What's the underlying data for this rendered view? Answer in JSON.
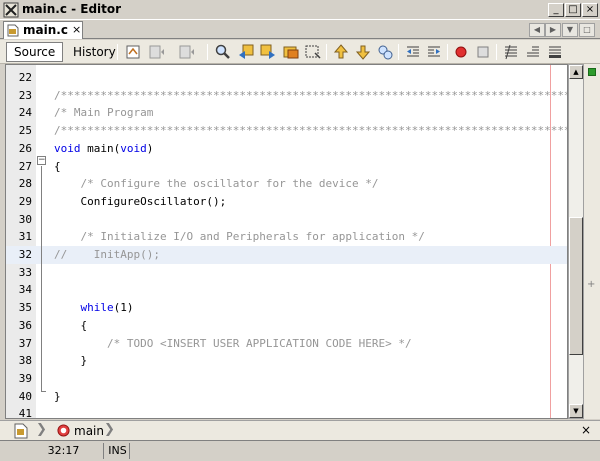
{
  "window": {
    "title": "main.c - Editor",
    "buttons": {
      "minimize": "_",
      "maximize": "□",
      "close": "×"
    }
  },
  "tabs": [
    {
      "label": "main.c",
      "close": "×"
    }
  ],
  "toolbar": {
    "source_label": "Source",
    "history_label": "History"
  },
  "editor": {
    "current_line": 32,
    "lines": [
      {
        "n": "22",
        "text": ""
      },
      {
        "n": "23",
        "text": "/******************************************************************************/"
      },
      {
        "n": "24",
        "text": "/* Main Program                                                               */"
      },
      {
        "n": "25",
        "text": "/******************************************************************************/"
      },
      {
        "n": "26",
        "text": "void main(void)"
      },
      {
        "n": "27",
        "text": "{"
      },
      {
        "n": "28",
        "text": "    /* Configure the oscillator for the device */"
      },
      {
        "n": "29",
        "text": "    ConfigureOscillator();"
      },
      {
        "n": "30",
        "text": ""
      },
      {
        "n": "31",
        "text": "    /* Initialize I/O and Peripherals for application */"
      },
      {
        "n": "32",
        "text": "//    InitApp();"
      },
      {
        "n": "33",
        "text": ""
      },
      {
        "n": "34",
        "text": ""
      },
      {
        "n": "35",
        "text": "    while(1)"
      },
      {
        "n": "36",
        "text": "    {"
      },
      {
        "n": "37",
        "text": "        /* TODO <INSERT USER APPLICATION CODE HERE> */"
      },
      {
        "n": "38",
        "text": "    }"
      },
      {
        "n": "39",
        "text": ""
      },
      {
        "n": "40",
        "text": "}"
      },
      {
        "n": "41",
        "text": ""
      }
    ]
  },
  "breadcrumb": {
    "function_label": "main",
    "close": "×"
  },
  "statusbar": {
    "position": "32:17",
    "mode": "INS"
  },
  "colors": {
    "keyword": "#0000e6",
    "comment": "#969696",
    "current_line_bg": "#e9eff8",
    "margin_line": "#f0a0a0"
  }
}
